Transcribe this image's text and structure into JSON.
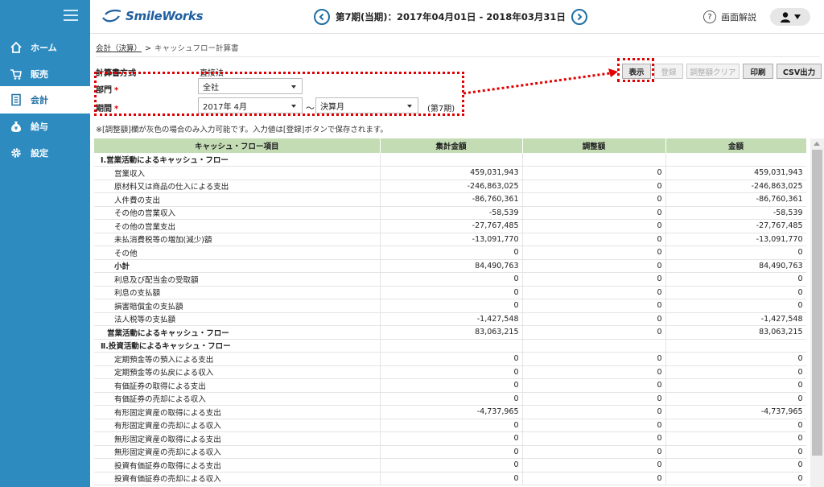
{
  "sidebar": {
    "items": [
      {
        "label": "ホーム",
        "icon": "home-icon"
      },
      {
        "label": "販売",
        "icon": "cart-icon"
      },
      {
        "label": "会計",
        "icon": "ledger-icon"
      },
      {
        "label": "給与",
        "icon": "moneybag-icon"
      },
      {
        "label": "設定",
        "icon": "gear-icon"
      }
    ],
    "active": "会計"
  },
  "header": {
    "logo_text": "SmileWorks",
    "period": "第7期(当期)：2017年04月01日 - 2018年03月31日",
    "help_label": "画面解説"
  },
  "breadcrumb": {
    "parent": "会計（決算）",
    "separator": ">",
    "current": "キャッシュフロー計算書"
  },
  "form": {
    "method_label": "計算書方式",
    "method_value": "直接法",
    "dept_label": "部門",
    "dept_value": "全社",
    "term_label": "期間",
    "term_from": "2017年 4月",
    "tilde": "～",
    "term_to": "決算月",
    "term_suffix": "(第7期)",
    "required_mark": "*",
    "note": "※[調整額]欄が灰色の場合のみ入力可能です。入力値は[登録]ボタンで保存されます。"
  },
  "toolbar": {
    "show": "表示",
    "register": "登録",
    "clear_adjust": "調整額クリア",
    "print": "印刷",
    "csv": "CSV出力"
  },
  "table": {
    "headers": [
      "キャッシュ・フロー項目",
      "集計金額",
      "調整額",
      "金額"
    ],
    "rows": [
      {
        "label": "Ⅰ.営業活動によるキャッシュ・フロー",
        "level": "section",
        "sum": "",
        "adj": "",
        "amt": ""
      },
      {
        "label": "営業収入",
        "level": "item",
        "sum": "459,031,943",
        "adj": "0",
        "amt": "459,031,943"
      },
      {
        "label": "原材料又は商品の仕入による支出",
        "level": "item",
        "sum": "-246,863,025",
        "adj": "0",
        "amt": "-246,863,025"
      },
      {
        "label": "人件費の支出",
        "level": "item",
        "sum": "-86,760,361",
        "adj": "0",
        "amt": "-86,760,361"
      },
      {
        "label": "その他の営業収入",
        "level": "item",
        "sum": "-58,539",
        "adj": "0",
        "amt": "-58,539"
      },
      {
        "label": "その他の営業支出",
        "level": "item",
        "sum": "-27,767,485",
        "adj": "0",
        "amt": "-27,767,485"
      },
      {
        "label": "未払消費税等の増加(減少)額",
        "level": "item",
        "sum": "-13,091,770",
        "adj": "0",
        "amt": "-13,091,770"
      },
      {
        "label": "その他",
        "level": "item",
        "sum": "0",
        "adj": "0",
        "amt": "0"
      },
      {
        "label": "小計",
        "level": "subtotal",
        "sum": "84,490,763",
        "adj": "0",
        "amt": "84,490,763"
      },
      {
        "label": "利息及び配当金の受取額",
        "level": "item",
        "sum": "0",
        "adj": "0",
        "amt": "0"
      },
      {
        "label": "利息の支払額",
        "level": "item",
        "sum": "0",
        "adj": "0",
        "amt": "0"
      },
      {
        "label": "損害賠償金の支払額",
        "level": "item",
        "sum": "0",
        "adj": "0",
        "amt": "0"
      },
      {
        "label": "法人税等の支払額",
        "level": "item",
        "sum": "-1,427,548",
        "adj": "0",
        "amt": "-1,427,548"
      },
      {
        "label": "営業活動によるキャッシュ・フロー",
        "level": "total",
        "sum": "83,063,215",
        "adj": "0",
        "amt": "83,063,215"
      },
      {
        "label": "Ⅱ.投資活動によるキャッシュ・フロー",
        "level": "section",
        "sum": "",
        "adj": "",
        "amt": ""
      },
      {
        "label": "定期預金等の預入による支出",
        "level": "item",
        "sum": "0",
        "adj": "0",
        "amt": "0"
      },
      {
        "label": "定期預金等の払戻による収入",
        "level": "item",
        "sum": "0",
        "adj": "0",
        "amt": "0"
      },
      {
        "label": "有価証券の取得による支出",
        "level": "item",
        "sum": "0",
        "adj": "0",
        "amt": "0"
      },
      {
        "label": "有価証券の売却による収入",
        "level": "item",
        "sum": "0",
        "adj": "0",
        "amt": "0"
      },
      {
        "label": "有形固定資産の取得による支出",
        "level": "item",
        "sum": "-4,737,965",
        "adj": "0",
        "amt": "-4,737,965"
      },
      {
        "label": "有形固定資産の売却による収入",
        "level": "item",
        "sum": "0",
        "adj": "0",
        "amt": "0"
      },
      {
        "label": "無形固定資産の取得による支出",
        "level": "item",
        "sum": "0",
        "adj": "0",
        "amt": "0"
      },
      {
        "label": "無形固定資産の売却による収入",
        "level": "item",
        "sum": "0",
        "adj": "0",
        "amt": "0"
      },
      {
        "label": "投資有価証券の取得による支出",
        "level": "item",
        "sum": "0",
        "adj": "0",
        "amt": "0"
      },
      {
        "label": "投資有価証券の売却による収入",
        "level": "item",
        "sum": "0",
        "adj": "0",
        "amt": "0"
      }
    ]
  },
  "colors": {
    "sidebar_bg": "#2e8bc0",
    "table_header_bg": "#c3dcb4",
    "highlight_red": "#e00000",
    "brand_blue": "#1f5fa0"
  }
}
